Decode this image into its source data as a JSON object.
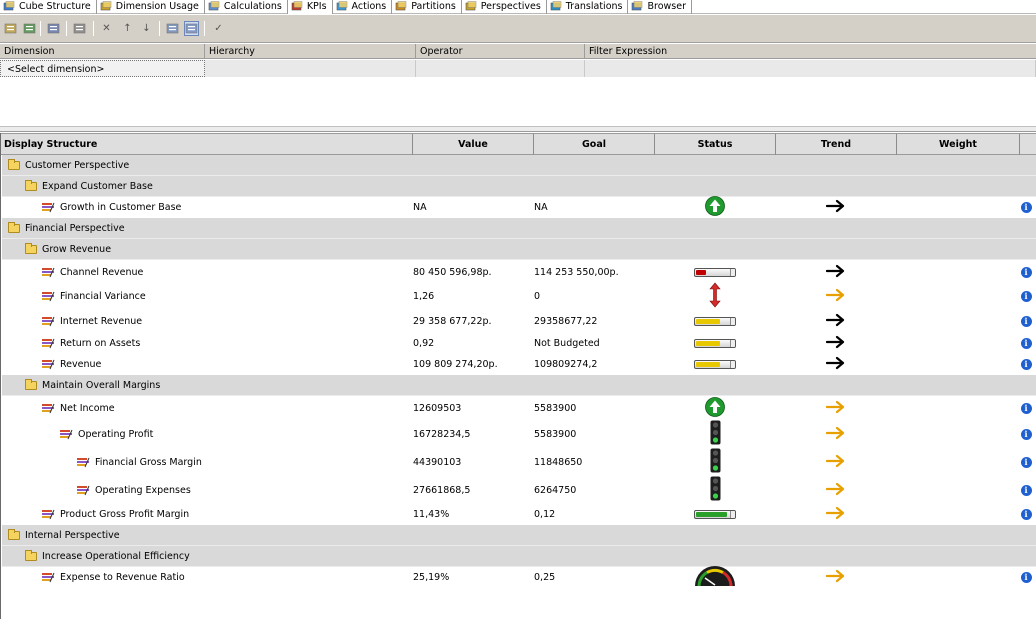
{
  "tabs": [
    {
      "label": "Cube Structure",
      "icon": "cube-structure-icon"
    },
    {
      "label": "Dimension Usage",
      "icon": "dimension-usage-icon"
    },
    {
      "label": "Calculations",
      "icon": "calculations-icon"
    },
    {
      "label": "KPIs",
      "icon": "kpis-icon",
      "active": true
    },
    {
      "label": "Actions",
      "icon": "actions-icon"
    },
    {
      "label": "Partitions",
      "icon": "partitions-icon"
    },
    {
      "label": "Perspectives",
      "icon": "perspectives-icon"
    },
    {
      "label": "Translations",
      "icon": "translations-icon"
    },
    {
      "label": "Browser",
      "icon": "browser-icon"
    }
  ],
  "toolbar": {
    "icons": [
      "reconnect-icon",
      "refresh-icon",
      "server-icon",
      "language-icon",
      "delete-icon",
      "move-up-icon",
      "move-down-icon",
      "filter-pane-icon",
      "calculations-view-icon",
      "check-icon"
    ]
  },
  "filter": {
    "headers": [
      "Dimension",
      "Hierarchy",
      "Operator",
      "Filter Expression"
    ],
    "row": {
      "dimension": "<Select dimension>",
      "hierarchy": "",
      "operator": "",
      "expression": ""
    }
  },
  "grid": {
    "headers": {
      "structure": "Display Structure",
      "value": "Value",
      "goal": "Goal",
      "status": "Status",
      "trend": "Trend",
      "weight": "Weight"
    },
    "rows": [
      {
        "type": "group",
        "level": 0,
        "name": "Customer Perspective"
      },
      {
        "type": "group",
        "level": 1,
        "name": "Expand Customer Base"
      },
      {
        "type": "kpi",
        "level": 2,
        "name": "Growth in Customer Base",
        "value": "NA",
        "goal": "NA",
        "status": "arrow-up-icon",
        "trend": "arrow-right-icon",
        "trend_color": "#000000"
      },
      {
        "type": "group",
        "level": 0,
        "name": "Financial Perspective"
      },
      {
        "type": "group",
        "level": 1,
        "name": "Grow Revenue"
      },
      {
        "type": "kpi",
        "level": 2,
        "name": "Channel Revenue",
        "value": "80 450 596,98р.",
        "goal": "114 253 550,00р.",
        "status": "gauge-bar-icon",
        "status_level": 0.3,
        "status_color": "#c00000",
        "trend": "arrow-right-icon",
        "trend_color": "#000000"
      },
      {
        "type": "kpi",
        "level": 2,
        "name": "Financial Variance",
        "value": "1,26",
        "goal": "0",
        "status": "double-arrow-icon",
        "trend": "arrow-right-icon",
        "trend_color": "#e8a000"
      },
      {
        "type": "kpi",
        "level": 2,
        "name": "Internet Revenue",
        "value": "29 358 677,22р.",
        "goal": "29358677,22",
        "status": "gauge-bar-icon",
        "status_level": 0.7,
        "status_color": "#e8c800",
        "trend": "arrow-right-icon",
        "trend_color": "#000000"
      },
      {
        "type": "kpi",
        "level": 2,
        "name": "Return on Assets",
        "value": "0,92",
        "goal": "Not Budgeted",
        "status": "gauge-bar-icon",
        "status_level": 0.7,
        "status_color": "#e8c800",
        "trend": "arrow-right-icon",
        "trend_color": "#000000"
      },
      {
        "type": "kpi",
        "level": 2,
        "name": "Revenue",
        "value": "109 809 274,20р.",
        "goal": "109809274,2",
        "status": "gauge-bar-icon",
        "status_level": 0.7,
        "status_color": "#e8c800",
        "trend": "arrow-right-icon",
        "trend_color": "#000000"
      },
      {
        "type": "group",
        "level": 1,
        "name": "Maintain Overall Margins"
      },
      {
        "type": "kpi",
        "level": 2,
        "name": "Net Income",
        "value": "12609503",
        "goal": "5583900",
        "status": "arrow-up-icon",
        "trend": "arrow-right-icon",
        "trend_color": "#e8a000"
      },
      {
        "type": "kpi",
        "level": 3,
        "name": "Operating Profit",
        "value": "16728234,5",
        "goal": "5583900",
        "status": "traffic-light-icon",
        "trend": "arrow-right-icon",
        "trend_color": "#e8a000"
      },
      {
        "type": "kpi",
        "level": 4,
        "name": "Financial Gross Margin",
        "value": "44390103",
        "goal": "11848650",
        "status": "traffic-light-icon",
        "trend": "arrow-right-icon",
        "trend_color": "#e8a000"
      },
      {
        "type": "kpi",
        "level": 4,
        "name": "Operating Expenses",
        "value": "27661868,5",
        "goal": "6264750",
        "status": "traffic-light-icon",
        "trend": "arrow-right-icon",
        "trend_color": "#e8a000"
      },
      {
        "type": "kpi",
        "level": 2,
        "name": "Product Gross Profit Margin",
        "value": "11,43%",
        "goal": "0,12",
        "status": "gauge-bar-icon",
        "status_level": 0.9,
        "status_color": "#2aa02a",
        "trend": "arrow-right-icon",
        "trend_color": "#e8a000"
      },
      {
        "type": "group",
        "level": 0,
        "name": "Internal Perspective"
      },
      {
        "type": "group",
        "level": 1,
        "name": "Increase Operational Efficiency"
      },
      {
        "type": "kpi",
        "level": 2,
        "name": "Expense to Revenue Ratio",
        "value": "25,19%",
        "goal": "0,25",
        "status": "speedometer-gauge-icon",
        "trend": "arrow-right-icon",
        "trend_color": "#e8a000"
      }
    ]
  },
  "colors": {
    "toolbar_bg": "#d4d0c8",
    "group_bg": "#d9d9d9",
    "info_blue": "#1f5fcf",
    "status_green": "#1f9a2e"
  }
}
